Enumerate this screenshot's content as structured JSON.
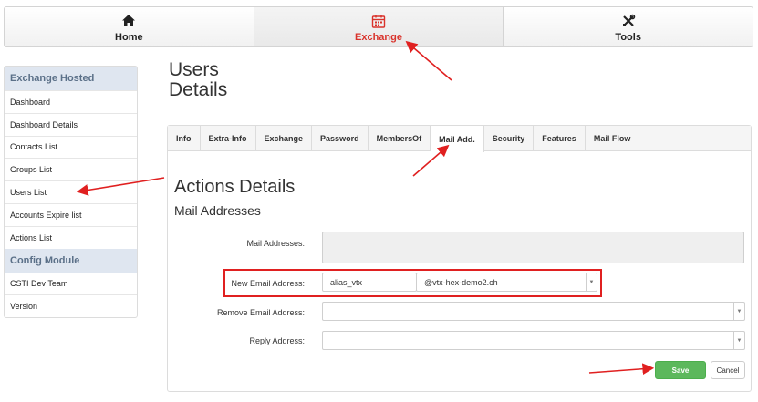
{
  "topnav": {
    "items": [
      {
        "label": "Home",
        "icon": "home-icon"
      },
      {
        "label": "Exchange",
        "icon": "calendar-icon",
        "active": true
      },
      {
        "label": "Tools",
        "icon": "tools-icon"
      }
    ]
  },
  "sidebar": {
    "section1": "Exchange Hosted",
    "items1": [
      "Dashboard",
      "Dashboard Details",
      "Contacts List",
      "Groups List",
      "Users List",
      "Accounts Expire list",
      "Actions List"
    ],
    "section2": "Config Module",
    "items2": [
      "CSTI Dev Team",
      "Version"
    ]
  },
  "page": {
    "title_line1": "Users",
    "title_line2": "Details"
  },
  "tabs": [
    "Info",
    "Extra-Info",
    "Exchange",
    "Password",
    "MembersOf",
    "Mail Add.",
    "Security",
    "Features",
    "Mail Flow"
  ],
  "active_tab": "Mail Add.",
  "form": {
    "actions_title": "Actions Details",
    "section_title": "Mail Addresses",
    "mail_addresses_label": "Mail Addresses:",
    "new_email_label": "New Email Address:",
    "new_email_alias": "alias_vtx",
    "new_email_domain": "@vtx-hex-demo2.ch",
    "remove_email_label": "Remove Email Address:",
    "reply_address_label": "Reply Address:",
    "save_label": "Save",
    "cancel_label": "Cancel"
  },
  "colors": {
    "accent_red": "#d9322b",
    "annotation_red": "#e02020",
    "save_green": "#5cb85c",
    "sidebar_header_bg": "#dfe6f0"
  }
}
